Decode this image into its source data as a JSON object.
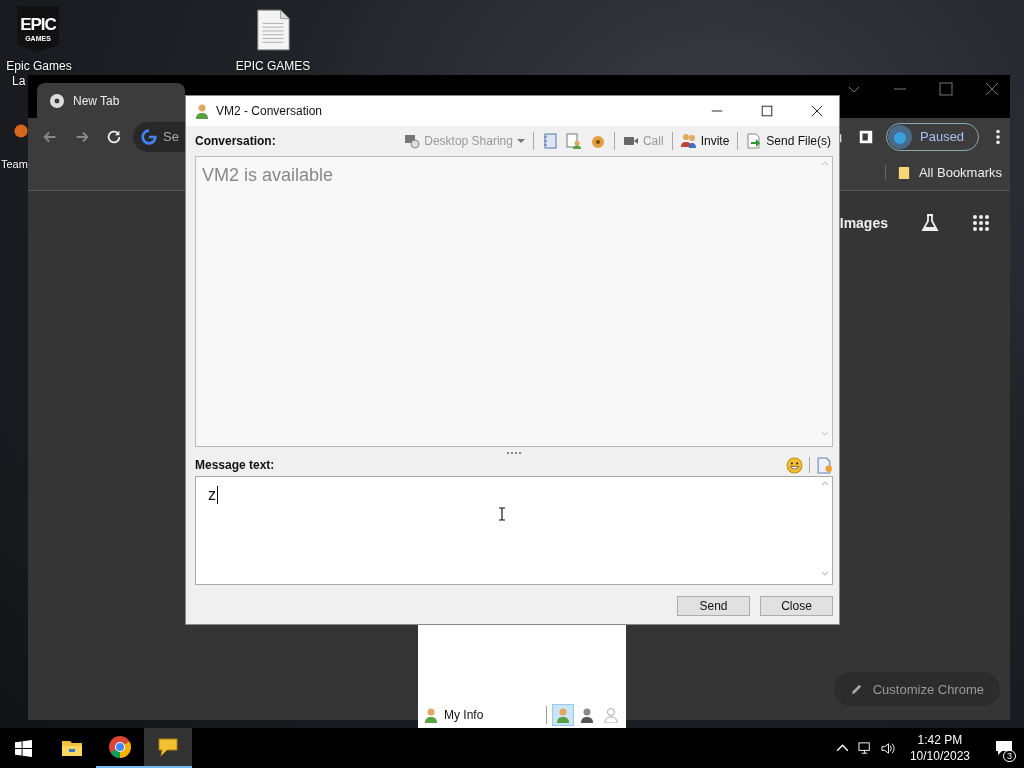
{
  "desktop": {
    "icons": [
      {
        "kind": "epic",
        "logo_text": [
          "EPIC",
          "GAMES"
        ],
        "label_lines": [
          "Epic Games",
          "La"
        ]
      },
      {
        "kind": "file",
        "label_lines": [
          "EPIC GAMES"
        ]
      },
      {
        "kind": "team",
        "label_lines": [
          "Team"
        ]
      }
    ]
  },
  "browser": {
    "tab": {
      "title": "New Tab",
      "selected": true
    },
    "search_placeholder": "Se",
    "profile": "Paused",
    "bookmark": "All Bookmarks",
    "link": "Images",
    "customize_button": "Customize Chrome"
  },
  "conversation": {
    "title": "VM2 - Conversation",
    "conversation_label": "Conversation:",
    "toolbar": [
      {
        "kind": "desktop-sharing",
        "label": "Desktop Sharing",
        "disabled": true,
        "dropdown": true
      },
      {
        "kind": "call",
        "label": "Call",
        "disabled": true,
        "dropdown": false
      },
      {
        "kind": "invite",
        "label": "Invite",
        "disabled": false,
        "dropdown": false
      },
      {
        "kind": "send-file",
        "label": "Send File(s)",
        "disabled": false,
        "dropdown": false
      }
    ],
    "status_text": "VM2 is available",
    "message_label": "Message text:",
    "message_value": "z",
    "buttons": [
      "Send",
      "Close"
    ]
  },
  "contacts": {
    "my_info": "My Info",
    "statuses": [
      {
        "kind": "online",
        "selected": true
      },
      {
        "kind": "busy",
        "selected": false
      },
      {
        "kind": "offline",
        "selected": false
      }
    ]
  },
  "taskbar": {
    "apps": [
      {
        "kind": "explorer",
        "running": false,
        "selected": false
      },
      {
        "kind": "chrome",
        "running": true,
        "selected": false
      },
      {
        "kind": "chat",
        "running": true,
        "selected": true
      }
    ],
    "time": "1:42 PM",
    "date": "10/10/2023",
    "notifications": "3"
  }
}
